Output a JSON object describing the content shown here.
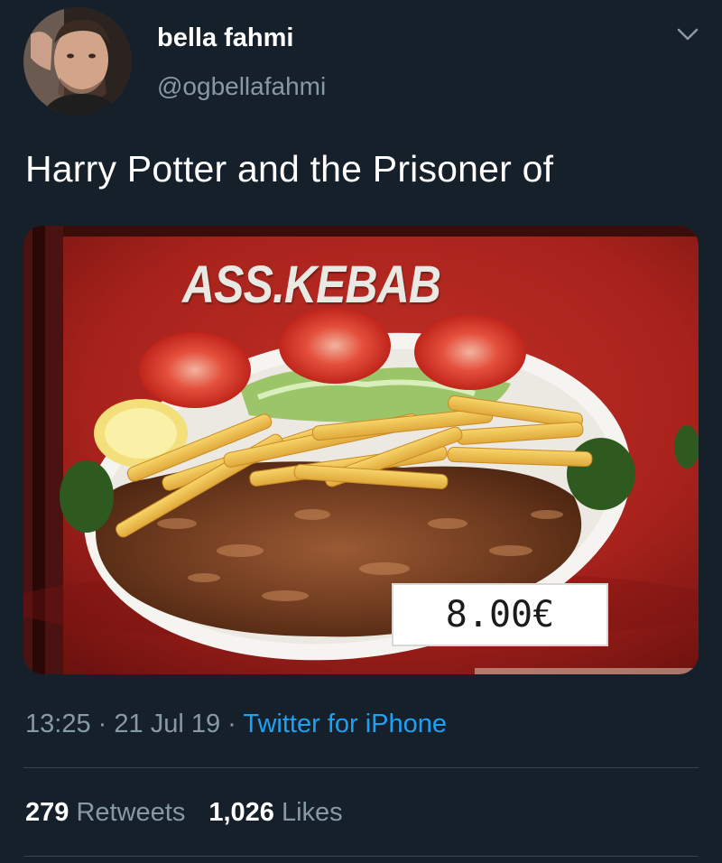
{
  "tweet": {
    "display_name": "bella fahmi",
    "handle": "@ogbellafahmi",
    "text": "Harry Potter and the Prisoner of",
    "time": "13:25",
    "date": "21 Jul 19",
    "source": "Twitter for iPhone",
    "separator": "·"
  },
  "media": {
    "sign_title": "ASS.KEBAB",
    "price": "8.00€"
  },
  "stats": {
    "retweets_count": "279",
    "retweets_label": "Retweets",
    "likes_count": "1,026",
    "likes_label": "Likes"
  },
  "icons": {
    "menu": "chevron-down-icon"
  },
  "colors": {
    "background": "#15202b",
    "secondary_text": "#8899a6",
    "link": "#1da1f2",
    "divider": "#38444d"
  }
}
